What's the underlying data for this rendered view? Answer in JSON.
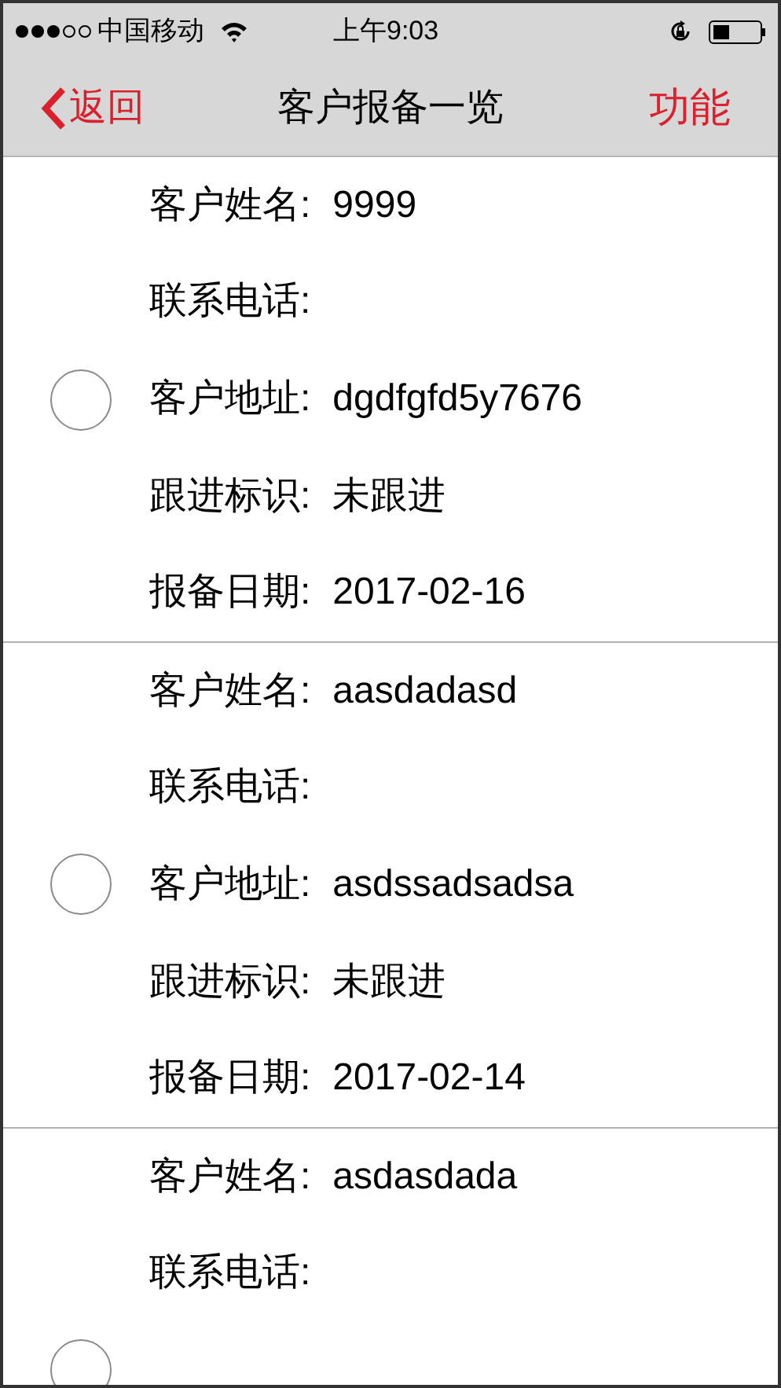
{
  "status_bar": {
    "carrier": "中国移动",
    "time": "上午9:03"
  },
  "nav": {
    "back": "返回",
    "title": "客户报备一览",
    "action": "功能"
  },
  "records": [
    {
      "selected": false,
      "fields": [
        {
          "label": "客户姓名:",
          "value": "9999"
        },
        {
          "label": "联系电话:"
        },
        {
          "label": "客户地址:",
          "value": "dgdfgfd5y7676"
        },
        {
          "label": "跟进标识:",
          "value": "未跟进"
        },
        {
          "label": "报备日期:",
          "value": "2017-02-16"
        }
      ]
    },
    {
      "selected": false,
      "fields": [
        {
          "label": "客户姓名:",
          "value": "aasdadasd"
        },
        {
          "label": "联系电话:"
        },
        {
          "label": "客户地址:",
          "value": "asdssadsadsa"
        },
        {
          "label": "跟进标识:",
          "value": "未跟进"
        },
        {
          "label": "报备日期:",
          "value": "2017-02-14"
        }
      ]
    },
    {
      "selected": false,
      "fields": [
        {
          "label": "客户姓名:",
          "value": "asdasdada"
        },
        {
          "label": "联系电话:"
        }
      ]
    }
  ]
}
